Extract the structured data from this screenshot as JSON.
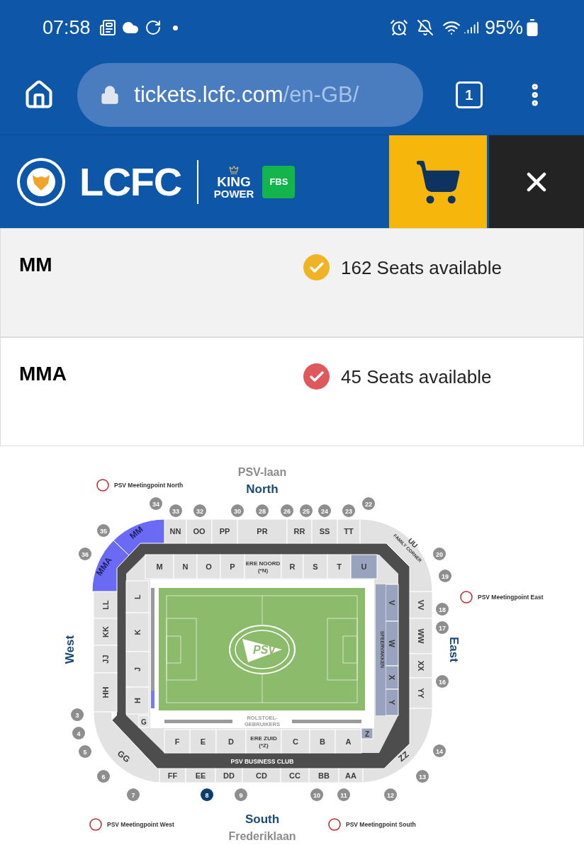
{
  "status_bar": {
    "time": "07:58",
    "battery": "95%"
  },
  "browser": {
    "url_host": "tickets.lcfc.com",
    "url_path": "/en-GB/",
    "tab_count": "1"
  },
  "header": {
    "logo_text": "LCFC",
    "sponsor_line_1": "KING",
    "sponsor_line_2": "POWER",
    "sponsor_badge": "FBS"
  },
  "sections": [
    {
      "name": "MM",
      "availability": "162 Seats available",
      "color": "#f0b323"
    },
    {
      "name": "MMA",
      "availability": "45 Seats available",
      "color": "#e0575c"
    }
  ],
  "stadium_map": {
    "street_north": "PSV-laan",
    "north": "North",
    "south": "South",
    "street_south": "Frederiklaan",
    "west": "West",
    "east": "East",
    "meetingpoints": [
      "PSV Meetingpoint North",
      "PSV Meetingpoint East",
      "PSV Meetingpoint West",
      "PSV Meetingpoint South"
    ],
    "gates": [
      {
        "label": "34",
        "selected": false
      },
      {
        "label": "33",
        "selected": false
      },
      {
        "label": "32",
        "selected": false
      },
      {
        "label": "30",
        "selected": false
      },
      {
        "label": "28",
        "selected": false
      },
      {
        "label": "26",
        "selected": false
      },
      {
        "label": "25",
        "selected": false
      },
      {
        "label": "24",
        "selected": false
      },
      {
        "label": "23",
        "selected": false
      },
      {
        "label": "22",
        "selected": false
      },
      {
        "label": "35",
        "selected": false
      },
      {
        "label": "36",
        "selected": false
      },
      {
        "label": "20",
        "selected": false
      },
      {
        "label": "19",
        "selected": false
      },
      {
        "label": "18",
        "selected": false
      },
      {
        "label": "17",
        "selected": false
      },
      {
        "label": "16",
        "selected": false
      },
      {
        "label": "3",
        "selected": false
      },
      {
        "label": "4",
        "selected": false
      },
      {
        "label": "5",
        "selected": false
      },
      {
        "label": "14",
        "selected": false
      },
      {
        "label": "6",
        "selected": false
      },
      {
        "label": "13",
        "selected": false
      },
      {
        "label": "7",
        "selected": false
      },
      {
        "label": "8",
        "selected": true
      },
      {
        "label": "9",
        "selected": false
      },
      {
        "label": "10",
        "selected": false
      },
      {
        "label": "11",
        "selected": false
      },
      {
        "label": "12",
        "selected": false
      }
    ],
    "upper_north": [
      {
        "label": "NN",
        "highlighted": false
      },
      {
        "label": "OO",
        "highlighted": false
      },
      {
        "label": "PP",
        "highlighted": false
      },
      {
        "label": "PR",
        "highlighted": false
      },
      {
        "label": "RR",
        "highlighted": false
      },
      {
        "label": "SS",
        "highlighted": false
      },
      {
        "label": "TT",
        "highlighted": false
      }
    ],
    "upper_west": [
      {
        "label": "LL",
        "highlighted": false
      },
      {
        "label": "KK",
        "highlighted": false
      },
      {
        "label": "JJ",
        "highlighted": false
      },
      {
        "label": "HH",
        "highlighted": false
      }
    ],
    "upper_east": [
      {
        "label": "VV",
        "highlighted": false
      },
      {
        "label": "WW",
        "highlighted": false
      },
      {
        "label": "XX",
        "highlighted": false
      },
      {
        "label": "YY",
        "highlighted": false
      }
    ],
    "upper_south": [
      {
        "label": "FF",
        "highlighted": false
      },
      {
        "label": "EE",
        "highlighted": false
      },
      {
        "label": "DD",
        "highlighted": false
      },
      {
        "label": "CD",
        "highlighted": false
      },
      {
        "label": "CC",
        "highlighted": false
      },
      {
        "label": "BB",
        "highlighted": false
      },
      {
        "label": "AA",
        "highlighted": false
      }
    ],
    "corners": [
      {
        "label": "MM",
        "highlighted": true
      },
      {
        "label": "MMA",
        "highlighted": true
      },
      {
        "label": "UU",
        "subtitle": "FAMILY CORNER",
        "highlighted": false
      },
      {
        "label": "GG",
        "highlighted": false
      },
      {
        "label": "ZZ",
        "highlighted": false
      }
    ],
    "lower_north": [
      {
        "label": "M",
        "kind": "standard"
      },
      {
        "label": "N",
        "kind": "standard"
      },
      {
        "label": "O",
        "kind": "standard"
      },
      {
        "label": "P",
        "kind": "standard"
      },
      {
        "label": "ERE NOORD",
        "sub": "(*N)",
        "kind": "standard"
      },
      {
        "label": "R",
        "kind": "standard"
      },
      {
        "label": "S",
        "kind": "standard"
      },
      {
        "label": "T",
        "kind": "standard"
      },
      {
        "label": "U",
        "kind": "sfeervak"
      }
    ],
    "lower_west": [
      {
        "label": "L",
        "kind": "standard"
      },
      {
        "label": "K",
        "kind": "standard"
      },
      {
        "label": "J",
        "kind": "standard"
      },
      {
        "label": "H",
        "kind": "standard"
      },
      {
        "label": "G",
        "kind": "standard"
      }
    ],
    "lower_east": [
      {
        "label": "V",
        "kind": "sfeervak"
      },
      {
        "label": "W",
        "kind": "sfeervak"
      },
      {
        "label": "X",
        "kind": "sfeervak"
      },
      {
        "label": "Y",
        "kind": "sfeervak"
      }
    ],
    "lower_south": [
      {
        "label": "F",
        "kind": "standard"
      },
      {
        "label": "E",
        "kind": "standard"
      },
      {
        "label": "D",
        "kind": "standard"
      },
      {
        "label": "ERE ZUID",
        "sub": "(*Z)",
        "kind": "standard"
      },
      {
        "label": "C",
        "kind": "standard"
      },
      {
        "label": "B",
        "kind": "standard"
      },
      {
        "label": "A",
        "kind": "standard"
      },
      {
        "label": "Z",
        "kind": "sfeervak"
      }
    ],
    "east_block_label": "SFEERVAKKEN",
    "wheelchair_label": [
      "ROLSTOEL-",
      "GEBRUIKERS"
    ],
    "business_club": "PSV BUSINESS CLUB",
    "crest_text": "PSV"
  }
}
